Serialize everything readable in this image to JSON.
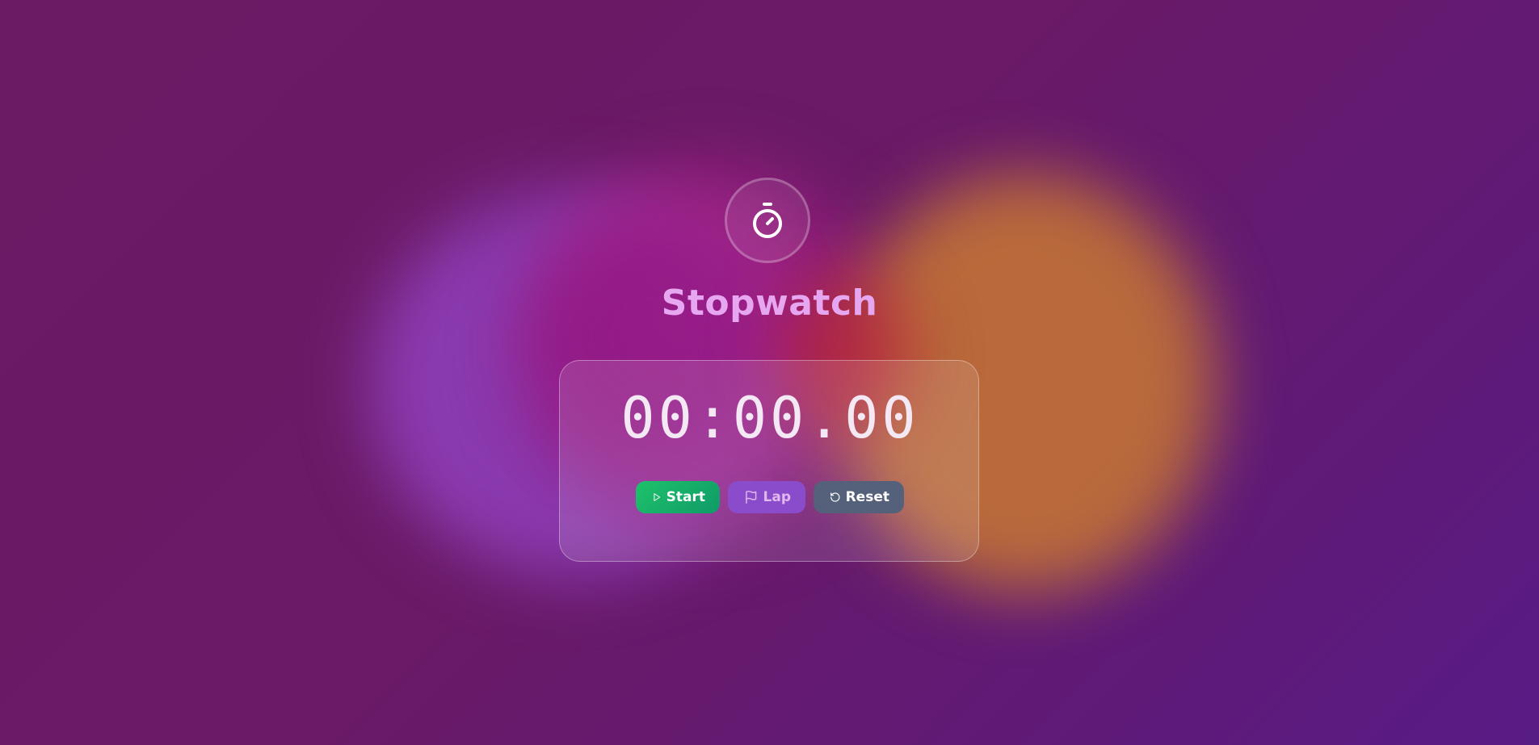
{
  "app": {
    "title": "Stopwatch",
    "logo_icon": "stopwatch-icon"
  },
  "display": {
    "time": "00:00.00"
  },
  "controls": {
    "start": {
      "label": "Start",
      "icon": "play-icon",
      "color": "#16b36a"
    },
    "lap": {
      "label": "Lap",
      "icon": "flag-icon",
      "color": "#8b4ccc"
    },
    "reset": {
      "label": "Reset",
      "icon": "rotate-ccw-icon",
      "color": "#55607a"
    }
  },
  "theme": {
    "background": "#6a1a66",
    "title_color": "#e6a6f0"
  }
}
